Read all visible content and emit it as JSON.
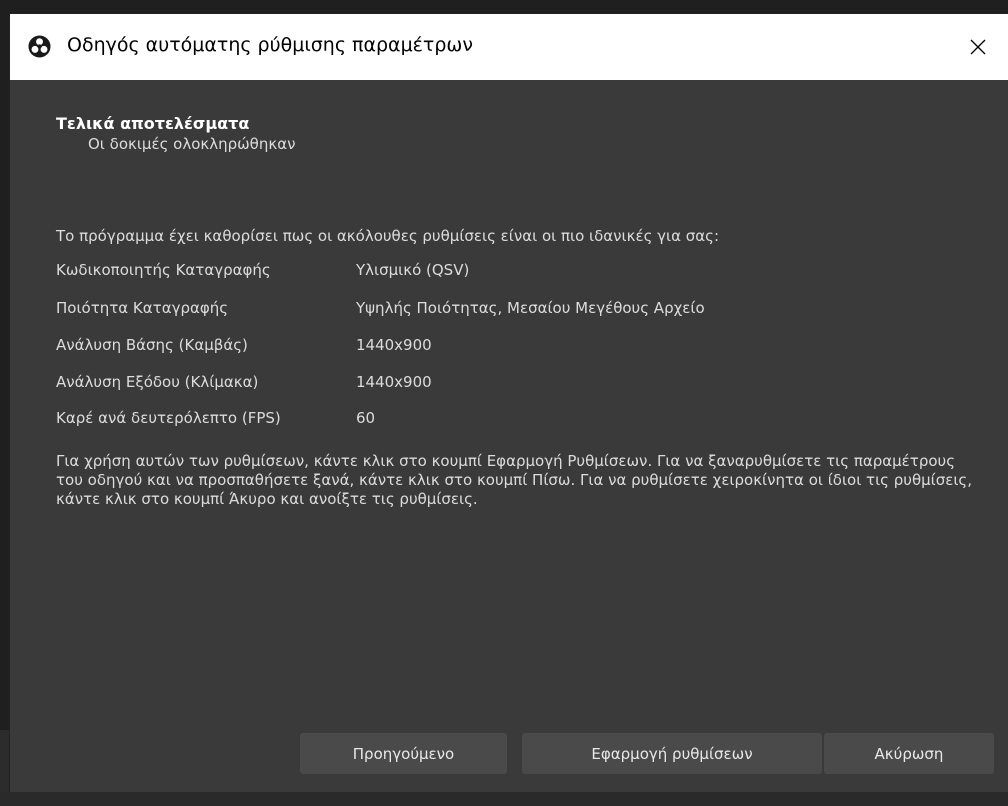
{
  "window": {
    "title": "Οδηγός αυτόματης ρύθμισης παραμέτρων",
    "app_icon": "obs-logo-icon",
    "close_icon": "close-icon"
  },
  "results": {
    "heading": "Τελικά αποτελέσματα",
    "subheading": "Οι δοκιμές ολοκληρώθηκαν",
    "intro": "Το πρόγραμμα έχει καθορίσει πως οι ακόλουθες ρυθμίσεις είναι οι πιο ιδανικές για σας:",
    "settings": [
      {
        "label": "Κωδικοποιητής Καταγραφής",
        "value": "Υλισμικό (QSV)"
      },
      {
        "label": "Ποιότητα Καταγραφής",
        "value": "Υψηλής Ποιότητας, Μεσαίου Μεγέθους Αρχείο"
      },
      {
        "label": "Ανάλυση Βάσης (Καμβάς)",
        "value": "1440x900"
      },
      {
        "label": "Ανάλυση Εξόδου (Κλίμακα)",
        "value": "1440x900"
      },
      {
        "label": "Καρέ ανά δευτερόλεπτο (FPS)",
        "value": "60"
      }
    ],
    "info": "Για χρήση αυτών των ρυθμίσεων, κάντε κλικ στο κουμπί Εφαρμογή Ρυθμίσεων. Για να ξαναρυθμίσετε τις παραμέτρους του οδηγού και να προσπαθήσετε ξανά, κάντε κλικ στο κουμπί Πίσω. Για να ρυθμίσετε χειροκίνητα οι ίδιοι τις ρυθμίσεις, κάντε κλικ στο κουμπί Άκυρο και ανοίξτε τις ρυθμίσεις."
  },
  "buttons": {
    "previous": "Προηγούμενο",
    "apply": "Εφαρμογή ρυθμίσεων",
    "cancel": "Ακύρωση"
  }
}
